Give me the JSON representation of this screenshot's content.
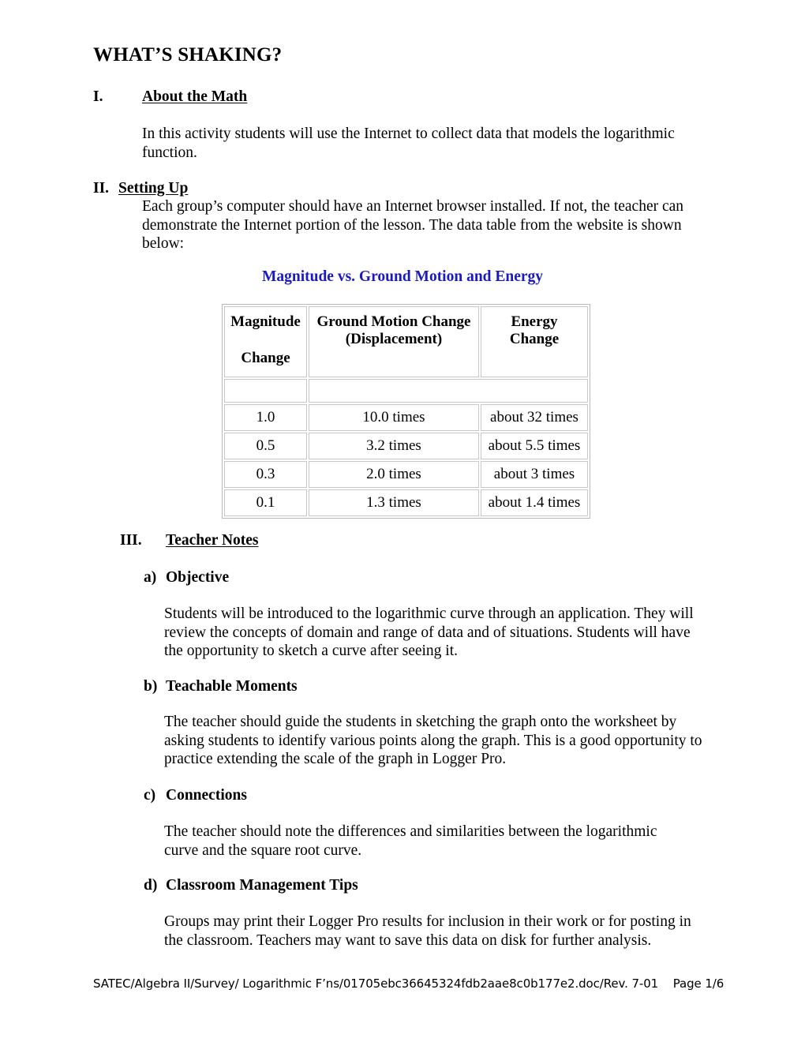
{
  "document": {
    "title": "WHAT’S SHAKING?"
  },
  "sections": [
    {
      "numeral": "I.",
      "label": "About the Math",
      "body": "In this activity students will use the Internet to collect data that models the logarithmic function."
    },
    {
      "numeral": "II.",
      "label": "Setting Up",
      "body": "Each group’s computer should have an Internet browser installed. If not, the teacher can demonstrate the Internet portion of the lesson. The data table from the website is shown below:"
    },
    {
      "numeral": "III.",
      "label": "Teacher Notes"
    }
  ],
  "table": {
    "caption": "Magnitude vs. Ground Motion and Energy",
    "caption_color": "#1a1ac0",
    "headers": {
      "magnitude_line1": "Magnitude",
      "magnitude_line2": "Change",
      "ground_motion_line1": "Ground Motion Change",
      "ground_motion_line2": "(Displacement)",
      "energy_line1": "Energy",
      "energy_line2": "Change"
    },
    "rows": [
      {
        "magnitude": "1.0",
        "ground_motion": "10.0 times",
        "energy": "about 32 times"
      },
      {
        "magnitude": "0.5",
        "ground_motion": "3.2 times",
        "energy": "about 5.5 times"
      },
      {
        "magnitude": "0.3",
        "ground_motion": "2.0 times",
        "energy": "about 3 times"
      },
      {
        "magnitude": "0.1",
        "ground_motion": "1.3 times",
        "energy": "about 1.4 times"
      }
    ]
  },
  "teacher_notes": [
    {
      "letter": "a)",
      "label": "Objective",
      "body": "Students will be introduced to the logarithmic curve through an application. They will review the concepts of domain and range of data and of situations. Students will have the opportunity to sketch a curve after seeing it."
    },
    {
      "letter": "b)",
      "label": "Teachable Moments",
      "body": "The teacher should guide the students in sketching the graph onto the worksheet by asking students to identify various points along the graph. This is a good opportunity to practice extending the scale of the graph in Logger Pro."
    },
    {
      "letter": "c)",
      "label": "Connections",
      "body": "The teacher should note the differences and similarities between the logarithmic curve and the square root curve."
    },
    {
      "letter": "d)",
      "label": "Classroom Management Tips",
      "body": "Groups may print their Logger Pro results for inclusion in their work or for posting in the classroom. Teachers may want to save this data on disk for further analysis."
    }
  ],
  "footer": {
    "text": "SATEC/Algebra II/Survey/ Logarithmic F’ns/01705ebc36645324fdb2aae8c0b177e2.doc/Rev. 7-01    Page 1/6"
  }
}
